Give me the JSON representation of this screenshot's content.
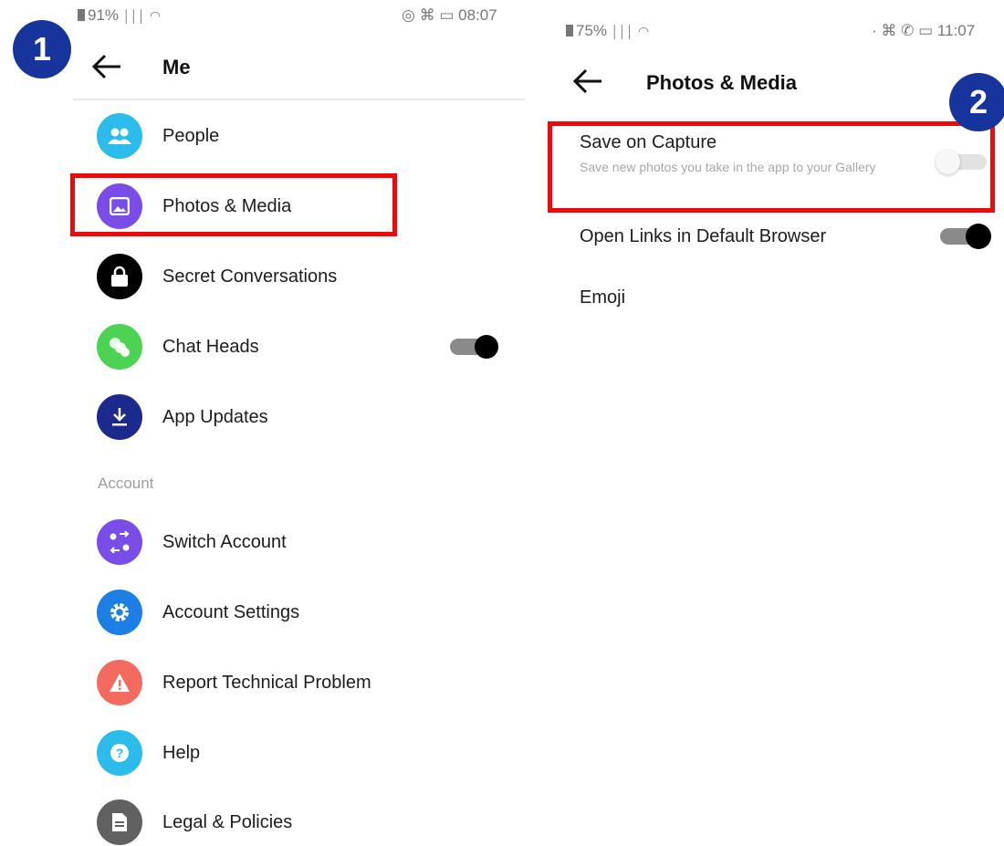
{
  "left_screen": {
    "status": {
      "battery": "91%",
      "time": "08:07"
    },
    "header": {
      "title": "Me"
    },
    "items": [
      {
        "label": "People",
        "icon": "people-icon",
        "color": "#2bbcec"
      },
      {
        "label": "Photos & Media",
        "icon": "photo-icon",
        "color": "#7b4de8"
      },
      {
        "label": "Secret Conversations",
        "icon": "lock-icon",
        "color": "#000000"
      },
      {
        "label": "Chat Heads",
        "icon": "chat-heads-icon",
        "color": "#4cd353",
        "toggle": true
      },
      {
        "label": "App Updates",
        "icon": "download-icon",
        "color": "#1c2a8e"
      }
    ],
    "account_header": "Account",
    "account_items": [
      {
        "label": "Switch Account",
        "icon": "switch-icon",
        "color": "#7b4de8"
      },
      {
        "label": "Account Settings",
        "icon": "gear-icon",
        "color": "#1d7fe5"
      },
      {
        "label": "Report Technical Problem",
        "icon": "warning-icon",
        "color": "#f26b5e"
      },
      {
        "label": "Help",
        "icon": "help-icon",
        "color": "#2bbcec"
      },
      {
        "label": "Legal & Policies",
        "icon": "document-icon",
        "color": "#616161"
      }
    ]
  },
  "right_screen": {
    "status": {
      "battery": "75%",
      "time": "11:07"
    },
    "header": {
      "title": "Photos & Media"
    },
    "save_on_capture": {
      "label": "Save on Capture",
      "description": "Save new photos you take in the app to your Gallery",
      "toggle": false
    },
    "open_links": {
      "label": "Open Links in Default Browser",
      "toggle": true
    },
    "emoji": {
      "label": "Emoji"
    }
  },
  "annotations": {
    "step1": "1",
    "step2": "2",
    "highlight_color": "#ee0a0a",
    "step_color": "#16349c"
  }
}
